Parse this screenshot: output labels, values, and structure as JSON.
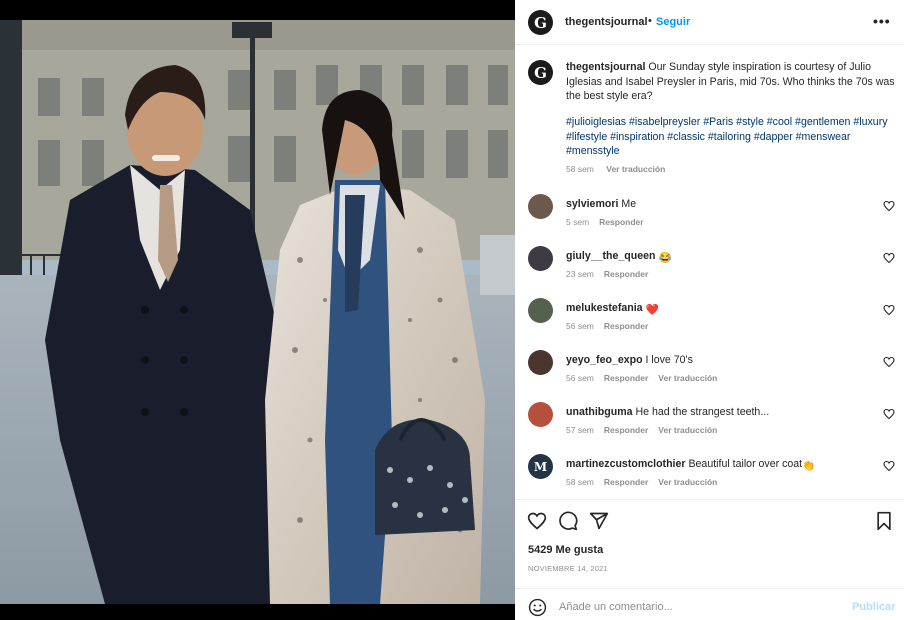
{
  "post": {
    "author": "thegentsjournal",
    "author_initial": "G",
    "dot": "•",
    "follow_label": "Seguir",
    "more_label": "•••",
    "caption": "Our Sunday style inspiration is courtesy of Julio Iglesias and Isabel Preysler in Paris, mid 70s. Who thinks the 70s was the best style era?",
    "hashtags": "#julioiglesias #isabelpreysler #Paris #style #cool #gentlemen #luxury #lifestyle #inspiration #classic #tailoring #dapper #menswear #mensstyle",
    "caption_age": "58 sem",
    "translate_label": "Ver traducción"
  },
  "comments": [
    {
      "user": "sylviemori",
      "text": "Me",
      "emoji": "",
      "age": "5 sem",
      "reply": "Responder",
      "translate": "",
      "avatar_color": "#6b5a4c"
    },
    {
      "user": "giuly__the_queen",
      "text": "",
      "emoji": "😂",
      "age": "23 sem",
      "reply": "Responder",
      "translate": "",
      "avatar_color": "#3d3a44"
    },
    {
      "user": "melukestefania",
      "text": "",
      "emoji": "❤️",
      "age": "56 sem",
      "reply": "Responder",
      "translate": "",
      "avatar_color": "#56604e"
    },
    {
      "user": "yeyo_feo_expo",
      "text": "I love 70's",
      "emoji": "",
      "age": "56 sem",
      "reply": "Responder",
      "translate": "Ver traducción",
      "avatar_color": "#4a3530"
    },
    {
      "user": "unathibguma",
      "text": "He had the strangest teeth...",
      "emoji": "",
      "age": "57 sem",
      "reply": "Responder",
      "translate": "Ver traducción",
      "avatar_color": "#b4503c"
    },
    {
      "user": "martinezcustomclothier",
      "text": "Beautiful tailor over coat",
      "emoji": "👏",
      "age": "58 sem",
      "reply": "Responder",
      "translate": "Ver traducción",
      "avatar_color": "#243447",
      "avatar_letter": "M"
    }
  ],
  "stats": {
    "likes": "5429 Me gusta",
    "date": "NOVIEMBRE 14, 2021"
  },
  "composer": {
    "placeholder": "Añade un comentario...",
    "post_label": "Publicar"
  },
  "icons": {
    "like": "heart-outline-icon",
    "comment": "comment-bubble-icon",
    "share": "paper-plane-icon",
    "save": "bookmark-icon",
    "emoji": "smiley-icon",
    "more": "ellipsis-icon"
  },
  "colors": {
    "link_blue": "#0095f6",
    "hashtag_blue": "#00376b",
    "muted": "#8e8e8e",
    "publish_disabled": "#b2dffc",
    "heart_red": "#ed4956"
  }
}
